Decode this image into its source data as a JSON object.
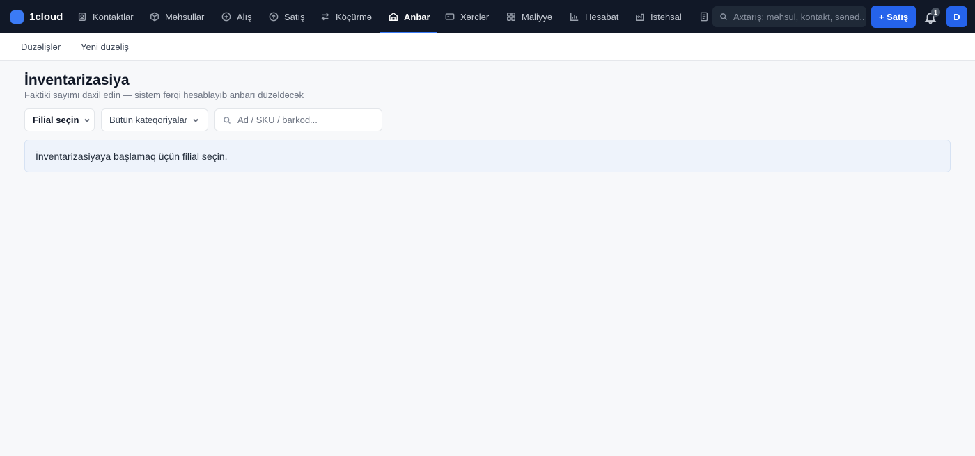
{
  "app": {
    "brand_name": "1cloud",
    "brand_color": "#3b7bf6"
  },
  "nav": {
    "items": [
      {
        "label": "Kontaktlar",
        "icon": "contacts-icon"
      },
      {
        "label": "Məhsullar",
        "icon": "box-icon"
      },
      {
        "label": "Alış",
        "icon": "plus-circle-icon"
      },
      {
        "label": "Satış",
        "icon": "arrow-up-circle-icon"
      },
      {
        "label": "Köçürmə",
        "icon": "transfer-icon"
      },
      {
        "label": "Anbar",
        "icon": "warehouse-icon",
        "active": true
      },
      {
        "label": "Xərclər",
        "icon": "wallet-icon"
      },
      {
        "label": "Maliyyə",
        "icon": "grid-icon"
      },
      {
        "label": "Hesabat",
        "icon": "bar-chart-icon"
      },
      {
        "label": "İstehsal",
        "icon": "factory-icon"
      }
    ],
    "overflow_icon": "document-icon"
  },
  "search": {
    "placeholder": "Axtarış: məhsul, kontakt, sənəd..."
  },
  "actions": {
    "new_sale_label": "+ Satış",
    "notification_count": "1",
    "avatar_initial": "D",
    "accent_color": "#2563eb"
  },
  "subnav": {
    "items": [
      {
        "label": "Düzəlişlər"
      },
      {
        "label": "Yeni düzəliş"
      }
    ]
  },
  "page": {
    "title": "İnventarizasiya",
    "subtitle": "Faktiki sayımı daxil edin — sistem fərqi hesablayıb anbarı düzəldəcək"
  },
  "filters": {
    "branch_select": "Filial seçin",
    "category_select": "Bütün kateqoriyalar",
    "item_search_placeholder": "Ad / SKU / barkod..."
  },
  "notice": {
    "text": "İnventarizasiyaya başlamaq üçün filial seçin."
  }
}
